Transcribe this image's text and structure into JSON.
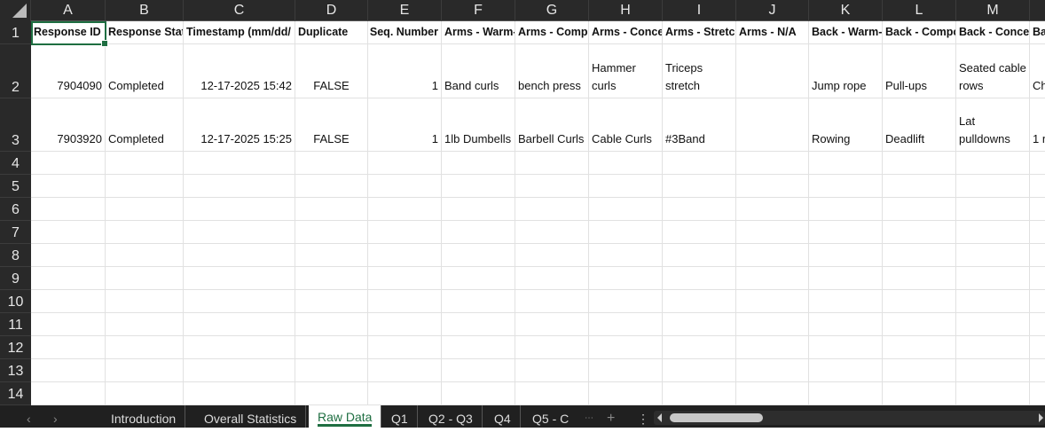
{
  "columns": [
    "A",
    "B",
    "C",
    "D",
    "E",
    "F",
    "G",
    "H",
    "I",
    "J",
    "K",
    "L",
    "M",
    ""
  ],
  "rows": [
    "1",
    "2",
    "3",
    "4",
    "5",
    "6",
    "7",
    "8",
    "9",
    "10",
    "11",
    "12",
    "13",
    "14"
  ],
  "cells": [
    [
      "Response ID",
      "Response Stat",
      "Timestamp (mm/dd/",
      "Duplicate",
      "Seq. Number",
      "Arms - Warm-",
      "Arms - Compo",
      "Arms - Concer",
      "Arms - Stretch",
      "Arms - N/A",
      "Back - Warm-",
      "Back - Compo",
      "Back - Concen",
      "Ba"
    ],
    [
      "7904090",
      "Completed",
      "12-17-2025 15:42",
      "FALSE",
      "1",
      "Band curls",
      "bench press",
      "Hammer curls",
      "Triceps stretch",
      "",
      "Jump rope",
      "Pull-ups",
      "Seated cable rows",
      "Ch"
    ],
    [
      "7903920",
      "Completed",
      "12-17-2025 15:25",
      "FALSE",
      "1",
      "1lb Dumbells",
      "Barbell Curls",
      "Cable Curls",
      "#3Band",
      "",
      "Rowing",
      "Deadlift",
      "Lat pulldowns",
      "1 r"
    ]
  ],
  "selected_cell": "A1",
  "sheet_tabs": [
    {
      "label": "Introduction",
      "active": false
    },
    {
      "label": "Overall Statistics",
      "active": false
    },
    {
      "label": "Raw Data",
      "active": true
    },
    {
      "label": "Q1",
      "active": false
    },
    {
      "label": "Q2 - Q3",
      "active": false
    },
    {
      "label": "Q4",
      "active": false
    },
    {
      "label": "Q5 - C",
      "active": false
    }
  ],
  "tab_nav": {
    "prev": "‹",
    "next": "›",
    "more": "⋯",
    "add": "+",
    "options": "⋮"
  },
  "colors": {
    "accent": "#1e6e41",
    "header_bg": "#292929"
  }
}
